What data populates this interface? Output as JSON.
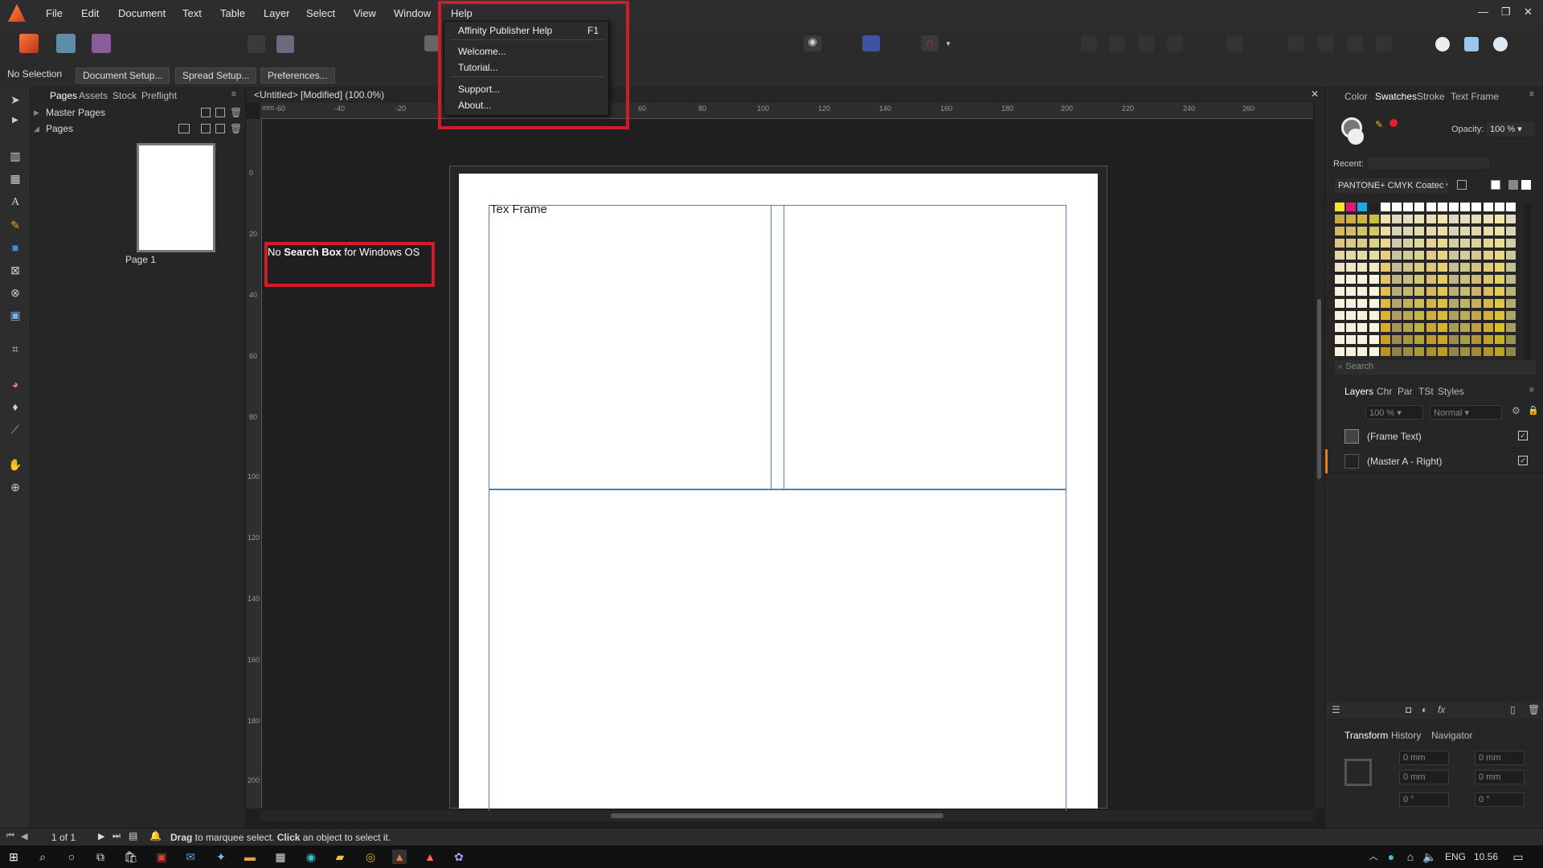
{
  "menubar": {
    "items": [
      "File",
      "Edit",
      "Document",
      "Text",
      "Table",
      "Layer",
      "Select",
      "View",
      "Window",
      "Help"
    ],
    "window_controls": [
      "—",
      "❐",
      "✕"
    ]
  },
  "help_menu": {
    "items": [
      {
        "label": "Affinity Publisher Help",
        "shortcut": "F1"
      },
      {
        "label": "Welcome...",
        "shortcut": ""
      },
      {
        "label": "Tutorial...",
        "shortcut": ""
      },
      {
        "label": "Support...",
        "shortcut": ""
      },
      {
        "label": "About...",
        "shortcut": ""
      }
    ]
  },
  "context_bar": {
    "selection": "No Selection",
    "buttons": [
      "Document Setup...",
      "Spread Setup...",
      "Preferences..."
    ]
  },
  "pages_panel": {
    "tabs": [
      "Pages",
      "Assets",
      "Stock",
      "Preflight"
    ],
    "master_pages": "Master Pages",
    "pages": "Pages",
    "page_label": "Page 1"
  },
  "document": {
    "title": "<Untitled> [Modified] (100.0%)",
    "frame_text": "Tex Frame"
  },
  "hruler_labels": [
    "-60",
    "-40",
    "-20",
    "60",
    "80",
    "100",
    "120",
    "140",
    "160",
    "180",
    "200",
    "220",
    "240",
    "260"
  ],
  "vruler_labels": [
    "0",
    "20",
    "40",
    "60",
    "80",
    "100",
    "120",
    "140",
    "160",
    "180",
    "200"
  ],
  "annotation": {
    "pre": "No ",
    "bold": "Search Box",
    "post": " for Windows OS"
  },
  "right_panel": {
    "top_tabs": [
      "Color",
      "Swatches",
      "Stroke",
      "Text Frame"
    ],
    "opacity_label": "Opacity:",
    "opacity_value": "100 %",
    "recent_label": "Recent:",
    "palette": "PANTONE+ CMYK Coatec",
    "search_placeholder": "Search",
    "layer_tabs": [
      "Layers",
      "Chr",
      "Par",
      "TSt",
      "Styles"
    ],
    "layer_opacity": "100 %",
    "blend_mode": "Normal",
    "layers": [
      "(Frame Text)",
      "(Master A - Right)"
    ],
    "bottom_tabs": [
      "Transform",
      "History",
      "Navigator"
    ],
    "transform_fields": {
      "x": "0 mm",
      "y": "0 mm",
      "w": "0 mm",
      "h": "0 mm",
      "r": "0 °",
      "s": "0 °"
    }
  },
  "status": {
    "page_count": "1 of 1",
    "hint_drag": "Drag",
    "hint_mid": " to marquee select. ",
    "hint_click": "Click",
    "hint_end": " an object to select it."
  },
  "taskbar": {
    "lang": "ENG",
    "time": "10.56"
  },
  "colors": {
    "accent_red": "#d11a2a",
    "frame_blue": "#4a7fc0",
    "swatch_red": "#e0202a"
  }
}
